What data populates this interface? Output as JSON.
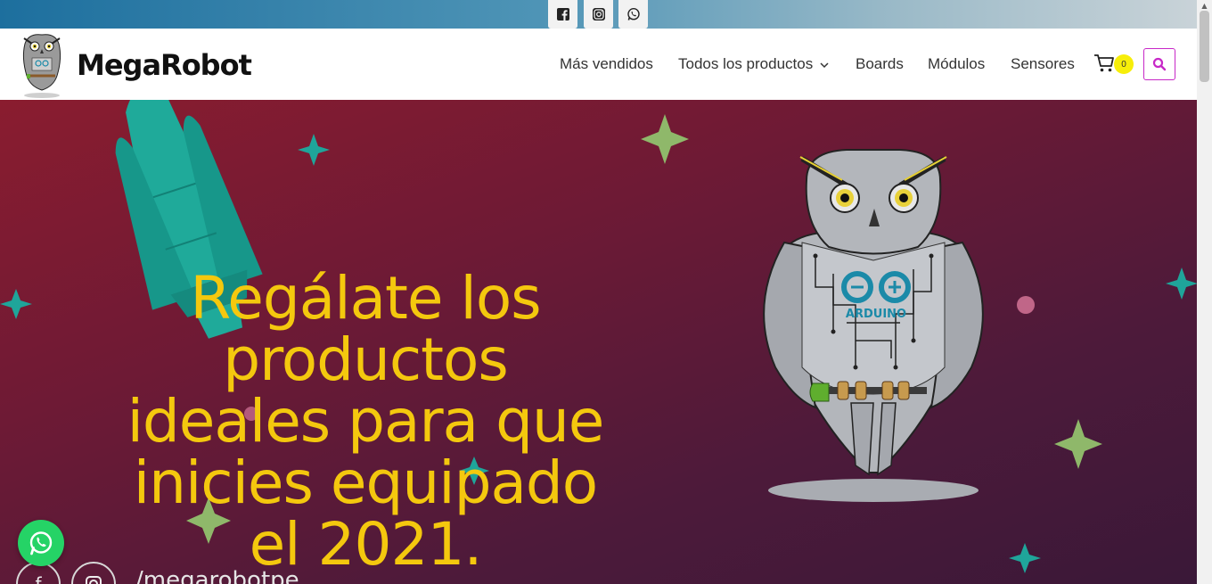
{
  "topbar": {
    "icons": [
      "facebook-icon",
      "instagram-icon",
      "whatsapp-icon"
    ]
  },
  "header": {
    "brand": "MegaRobot",
    "nav": [
      {
        "label": "Más vendidos"
      },
      {
        "label": "Todos los productos"
      },
      {
        "label": "Boards"
      },
      {
        "label": "Módulos"
      },
      {
        "label": "Sensores"
      }
    ],
    "cart_count": "0"
  },
  "hero": {
    "headline": "Regálate los productos ideales para que inicies equipado el 2021.",
    "handle": "/megarobotpe",
    "owl_board_label": "ARDUINO"
  },
  "colors": {
    "accent_yellow": "#f4c80e",
    "search_border": "#c728c7",
    "whatsapp_green": "#25d366",
    "hero_bg": "#6e1a35"
  }
}
